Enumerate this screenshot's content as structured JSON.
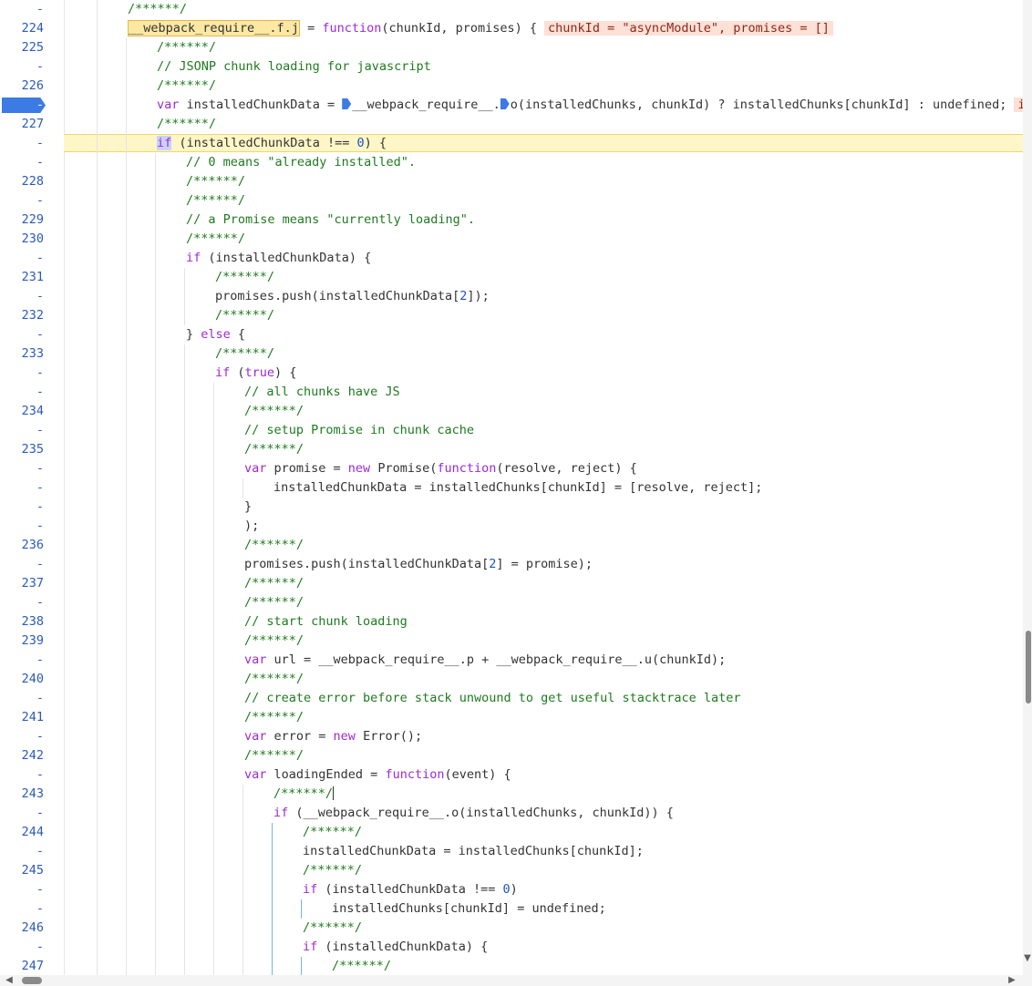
{
  "editor": {
    "lines": [
      {
        "ln": "-",
        "code": "/******/"
      },
      {
        "ln": "224",
        "code": "__webpack_require__.f.j = function(chunkId, promises) {",
        "inline": "chunkId = \"asyncModule\", promises = []"
      },
      {
        "ln": "225",
        "code": "/******/"
      },
      {
        "ln": "-",
        "code": "// JSONP chunk loading for javascript"
      },
      {
        "ln": "226",
        "code": "/******/"
      },
      {
        "ln": "-",
        "code": "var installedChunkData = __webpack_require__.o(installedChunks, chunkId) ? installedChunks[chunkId] : undefined;",
        "inline": "in"
      },
      {
        "ln": "227",
        "code": "/******/"
      },
      {
        "ln": "-",
        "code": "if (installedChunkData !== 0) {"
      },
      {
        "ln": "-",
        "code": "// 0 means \"already installed\"."
      },
      {
        "ln": "228",
        "code": "/******/"
      },
      {
        "ln": "-",
        "code": "/******/"
      },
      {
        "ln": "229",
        "code": "// a Promise means \"currently loading\"."
      },
      {
        "ln": "230",
        "code": "/******/"
      },
      {
        "ln": "-",
        "code": "if (installedChunkData) {"
      },
      {
        "ln": "231",
        "code": "/******/"
      },
      {
        "ln": "-",
        "code": "promises.push(installedChunkData[2]);"
      },
      {
        "ln": "232",
        "code": "/******/"
      },
      {
        "ln": "-",
        "code": "} else {"
      },
      {
        "ln": "233",
        "code": "/******/"
      },
      {
        "ln": "-",
        "code": "if (true) {"
      },
      {
        "ln": "-",
        "code": "// all chunks have JS"
      },
      {
        "ln": "234",
        "code": "/******/"
      },
      {
        "ln": "-",
        "code": "// setup Promise in chunk cache"
      },
      {
        "ln": "235",
        "code": "/******/"
      },
      {
        "ln": "-",
        "code": "var promise = new Promise(function(resolve, reject) {"
      },
      {
        "ln": "-",
        "code": "installedChunkData = installedChunks[chunkId] = [resolve, reject];"
      },
      {
        "ln": "-",
        "code": "}"
      },
      {
        "ln": "-",
        "code": ");"
      },
      {
        "ln": "236",
        "code": "/******/"
      },
      {
        "ln": "-",
        "code": "promises.push(installedChunkData[2] = promise);"
      },
      {
        "ln": "237",
        "code": "/******/"
      },
      {
        "ln": "-",
        "code": "/******/"
      },
      {
        "ln": "238",
        "code": "// start chunk loading"
      },
      {
        "ln": "239",
        "code": "/******/"
      },
      {
        "ln": "-",
        "code": "var url = __webpack_require__.p + __webpack_require__.u(chunkId);"
      },
      {
        "ln": "240",
        "code": "/******/"
      },
      {
        "ln": "-",
        "code": "// create error before stack unwound to get useful stacktrace later"
      },
      {
        "ln": "241",
        "code": "/******/"
      },
      {
        "ln": "-",
        "code": "var error = new Error();"
      },
      {
        "ln": "242",
        "code": "/******/"
      },
      {
        "ln": "-",
        "code": "var loadingEnded = function(event) {"
      },
      {
        "ln": "243",
        "code": "/******/"
      },
      {
        "ln": "-",
        "code": "if (__webpack_require__.o(installedChunks, chunkId)) {"
      },
      {
        "ln": "244",
        "code": "/******/"
      },
      {
        "ln": "-",
        "code": "installedChunkData = installedChunks[chunkId];"
      },
      {
        "ln": "245",
        "code": "/******/"
      },
      {
        "ln": "-",
        "code": "if (installedChunkData !== 0)"
      },
      {
        "ln": "-",
        "code": "installedChunks[chunkId] = undefined;"
      },
      {
        "ln": "246",
        "code": "/******/"
      },
      {
        "ln": "-",
        "code": "if (installedChunkData) {"
      },
      {
        "ln": "247",
        "code": "/******/"
      }
    ]
  },
  "breakpoint": {
    "line_index": 5,
    "label": "-"
  },
  "paused_line_index": 7,
  "colors": {
    "comment": "#1f7a1f",
    "keyword": "#9c2ad1",
    "number": "#1a53c9",
    "line_number": "#2a5bb8",
    "breakpoint": "#3b7be3",
    "paused_highlight": "#fff6c7",
    "inline_value_bg": "#fde0d6"
  },
  "icons": {
    "scroll_left": "triangle-left-icon",
    "scroll_right": "triangle-right-icon",
    "scroll_down": "triangle-down-icon"
  }
}
